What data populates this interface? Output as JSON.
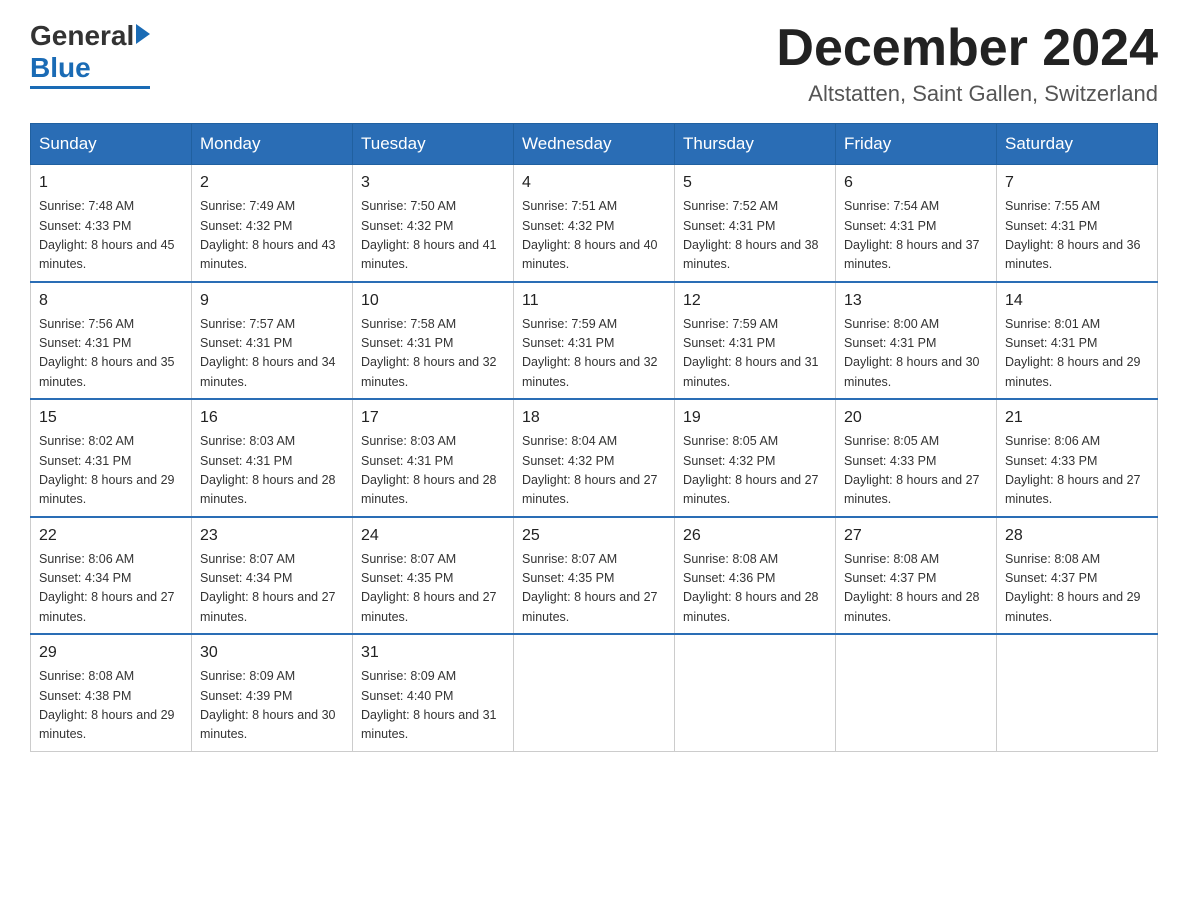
{
  "header": {
    "logo_general": "General",
    "logo_blue": "Blue",
    "month_title": "December 2024",
    "location": "Altstatten, Saint Gallen, Switzerland"
  },
  "days_of_week": [
    "Sunday",
    "Monday",
    "Tuesday",
    "Wednesday",
    "Thursday",
    "Friday",
    "Saturday"
  ],
  "weeks": [
    [
      {
        "num": "1",
        "sunrise": "7:48 AM",
        "sunset": "4:33 PM",
        "daylight": "8 hours and 45 minutes."
      },
      {
        "num": "2",
        "sunrise": "7:49 AM",
        "sunset": "4:32 PM",
        "daylight": "8 hours and 43 minutes."
      },
      {
        "num": "3",
        "sunrise": "7:50 AM",
        "sunset": "4:32 PM",
        "daylight": "8 hours and 41 minutes."
      },
      {
        "num": "4",
        "sunrise": "7:51 AM",
        "sunset": "4:32 PM",
        "daylight": "8 hours and 40 minutes."
      },
      {
        "num": "5",
        "sunrise": "7:52 AM",
        "sunset": "4:31 PM",
        "daylight": "8 hours and 38 minutes."
      },
      {
        "num": "6",
        "sunrise": "7:54 AM",
        "sunset": "4:31 PM",
        "daylight": "8 hours and 37 minutes."
      },
      {
        "num": "7",
        "sunrise": "7:55 AM",
        "sunset": "4:31 PM",
        "daylight": "8 hours and 36 minutes."
      }
    ],
    [
      {
        "num": "8",
        "sunrise": "7:56 AM",
        "sunset": "4:31 PM",
        "daylight": "8 hours and 35 minutes."
      },
      {
        "num": "9",
        "sunrise": "7:57 AM",
        "sunset": "4:31 PM",
        "daylight": "8 hours and 34 minutes."
      },
      {
        "num": "10",
        "sunrise": "7:58 AM",
        "sunset": "4:31 PM",
        "daylight": "8 hours and 32 minutes."
      },
      {
        "num": "11",
        "sunrise": "7:59 AM",
        "sunset": "4:31 PM",
        "daylight": "8 hours and 32 minutes."
      },
      {
        "num": "12",
        "sunrise": "7:59 AM",
        "sunset": "4:31 PM",
        "daylight": "8 hours and 31 minutes."
      },
      {
        "num": "13",
        "sunrise": "8:00 AM",
        "sunset": "4:31 PM",
        "daylight": "8 hours and 30 minutes."
      },
      {
        "num": "14",
        "sunrise": "8:01 AM",
        "sunset": "4:31 PM",
        "daylight": "8 hours and 29 minutes."
      }
    ],
    [
      {
        "num": "15",
        "sunrise": "8:02 AM",
        "sunset": "4:31 PM",
        "daylight": "8 hours and 29 minutes."
      },
      {
        "num": "16",
        "sunrise": "8:03 AM",
        "sunset": "4:31 PM",
        "daylight": "8 hours and 28 minutes."
      },
      {
        "num": "17",
        "sunrise": "8:03 AM",
        "sunset": "4:31 PM",
        "daylight": "8 hours and 28 minutes."
      },
      {
        "num": "18",
        "sunrise": "8:04 AM",
        "sunset": "4:32 PM",
        "daylight": "8 hours and 27 minutes."
      },
      {
        "num": "19",
        "sunrise": "8:05 AM",
        "sunset": "4:32 PM",
        "daylight": "8 hours and 27 minutes."
      },
      {
        "num": "20",
        "sunrise": "8:05 AM",
        "sunset": "4:33 PM",
        "daylight": "8 hours and 27 minutes."
      },
      {
        "num": "21",
        "sunrise": "8:06 AM",
        "sunset": "4:33 PM",
        "daylight": "8 hours and 27 minutes."
      }
    ],
    [
      {
        "num": "22",
        "sunrise": "8:06 AM",
        "sunset": "4:34 PM",
        "daylight": "8 hours and 27 minutes."
      },
      {
        "num": "23",
        "sunrise": "8:07 AM",
        "sunset": "4:34 PM",
        "daylight": "8 hours and 27 minutes."
      },
      {
        "num": "24",
        "sunrise": "8:07 AM",
        "sunset": "4:35 PM",
        "daylight": "8 hours and 27 minutes."
      },
      {
        "num": "25",
        "sunrise": "8:07 AM",
        "sunset": "4:35 PM",
        "daylight": "8 hours and 27 minutes."
      },
      {
        "num": "26",
        "sunrise": "8:08 AM",
        "sunset": "4:36 PM",
        "daylight": "8 hours and 28 minutes."
      },
      {
        "num": "27",
        "sunrise": "8:08 AM",
        "sunset": "4:37 PM",
        "daylight": "8 hours and 28 minutes."
      },
      {
        "num": "28",
        "sunrise": "8:08 AM",
        "sunset": "4:37 PM",
        "daylight": "8 hours and 29 minutes."
      }
    ],
    [
      {
        "num": "29",
        "sunrise": "8:08 AM",
        "sunset": "4:38 PM",
        "daylight": "8 hours and 29 minutes."
      },
      {
        "num": "30",
        "sunrise": "8:09 AM",
        "sunset": "4:39 PM",
        "daylight": "8 hours and 30 minutes."
      },
      {
        "num": "31",
        "sunrise": "8:09 AM",
        "sunset": "4:40 PM",
        "daylight": "8 hours and 31 minutes."
      },
      null,
      null,
      null,
      null
    ]
  ]
}
